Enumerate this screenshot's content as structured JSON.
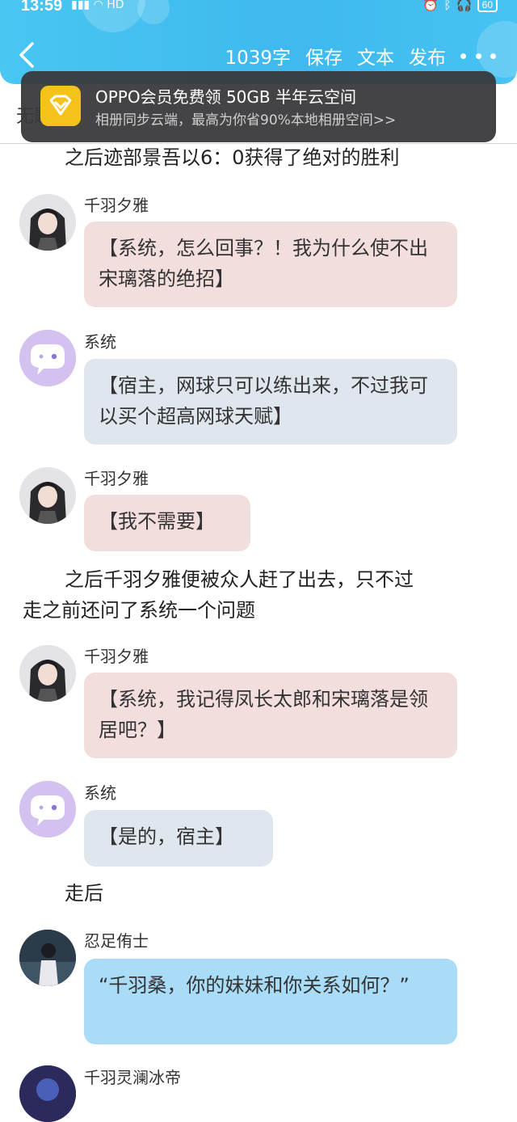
{
  "status_bar": {
    "time": "13:59",
    "net_label": "HD",
    "battery": "60"
  },
  "toolbar": {
    "word_count": "1039字",
    "save": "保存",
    "text": "文本",
    "publish": "发布"
  },
  "title_partial": "无题",
  "toast": {
    "title": "OPPO会员免费领 50GB 半年云空间",
    "subtitle": "相册同步云端，最高为你省90%本地相册空间>>"
  },
  "colors": {
    "header": "#3fb9ee",
    "bubble_qianyu": "#f3dede",
    "bubble_system": "#dfe6ee",
    "bubble_ren": "#a9dcf7"
  },
  "content": {
    "narr1": "之后迹部景吾以6：0获得了绝对的胜利",
    "m1": {
      "sender": "千羽夕雅",
      "text": "【系统，怎么回事？！我为什么使不出宋璃落的绝招】"
    },
    "m2": {
      "sender": "系统",
      "text": "【宿主，网球只可以练出来，不过我可以买个超高网球天赋】"
    },
    "m3": {
      "sender": "千羽夕雅",
      "text": "【我不需要】"
    },
    "narr2_line1": "之后千羽夕雅便被众人赶了出去，只不过",
    "narr2_line2": "走之前还问了系统一个问题",
    "m4": {
      "sender": "千羽夕雅",
      "text": "【系统，我记得凤长太郎和宋璃落是领居吧？】"
    },
    "m5": {
      "sender": "系统",
      "text": "【是的，宿主】"
    },
    "narr3": "走后",
    "m6": {
      "sender": "忍足侑士",
      "text": "“千羽桑，你的妹妹和你关系如何？”"
    },
    "m7": {
      "sender": "千羽灵澜冰帝"
    }
  }
}
